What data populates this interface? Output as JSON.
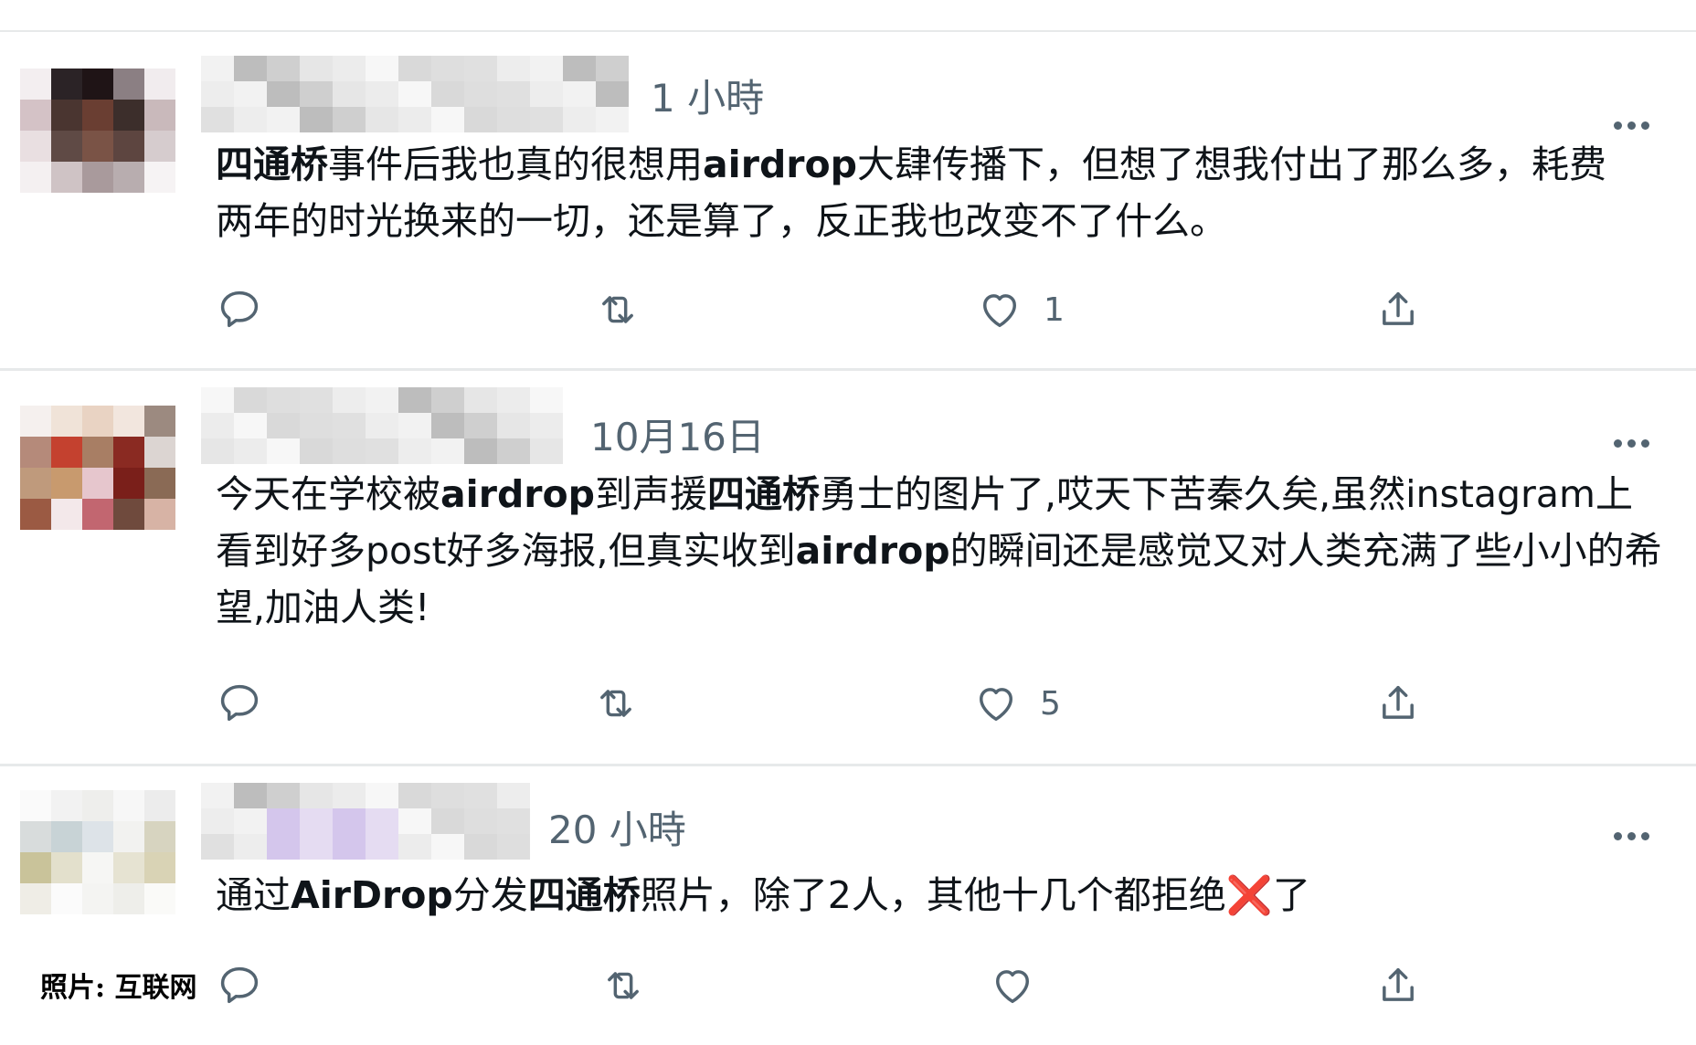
{
  "tweets": [
    {
      "time": "1 小時",
      "text_parts": [
        {
          "t": "四通桥",
          "b": true
        },
        {
          "t": "事件后我也真的很想用",
          "b": false
        },
        {
          "t": "airdrop",
          "b": true
        },
        {
          "t": "大肆传播下，但想了想我付出了那么多，耗费两年的时光换来的一切，还是算了，反正我也改变不了什么。",
          "b": false
        }
      ],
      "likes": "1",
      "avatar_colors": [
        "#f3eef0",
        "#2b2326",
        "#1f1416",
        "#8b7f83",
        "#f1ecee",
        "#d4c2c6",
        "#4a3530",
        "#6a3e32",
        "#3c2e2b",
        "#c9b9bb",
        "#e9dfe1",
        "#5f4a45",
        "#7a5346",
        "#5d4540",
        "#d6ccce",
        "#f4f0f1",
        "#cfc3c5",
        "#a99a9c",
        "#b8adaf",
        "#f6f3f4"
      ]
    },
    {
      "time": "10月16日",
      "text_parts": [
        {
          "t": "今天在学校被",
          "b": false
        },
        {
          "t": "airdrop",
          "b": true
        },
        {
          "t": "到声援",
          "b": false
        },
        {
          "t": "四通桥",
          "b": true
        },
        {
          "t": "勇士的图片了,哎天下苦秦久矣,虽然instagram上看到好多post好多海报,但真实收到",
          "b": false
        },
        {
          "t": "airdrop",
          "b": true
        },
        {
          "t": "的瞬间还是感觉又对人类充满了些小小的希望,加油人类!",
          "b": false
        }
      ],
      "likes": "5",
      "avatar_colors": [
        "#f5f0ee",
        "#f0e3d8",
        "#e9d3c3",
        "#f2e6de",
        "#9c8a80",
        "#b58a7a",
        "#c4412f",
        "#a87e64",
        "#8a2a22",
        "#dcd5d2",
        "#bf9a7c",
        "#c89a6e",
        "#e6c6cd",
        "#7a1f1a",
        "#8a6a55",
        "#9b5a43",
        "#f3e8ea",
        "#c26670",
        "#6f4a3d",
        "#d7b3a5"
      ]
    },
    {
      "time": "20 小時",
      "text_parts": [
        {
          "t": "通过",
          "b": false
        },
        {
          "t": "AirDrop",
          "b": true
        },
        {
          "t": "分发",
          "b": false
        },
        {
          "t": "四通桥",
          "b": true
        },
        {
          "t": "照片，除了2人，其他十几个都拒绝",
          "b": false
        },
        {
          "t": "❌",
          "b": false,
          "x": true
        },
        {
          "t": "了",
          "b": false
        }
      ],
      "likes": "",
      "avatar_colors": [
        "#fafafa",
        "#f2f2f2",
        "#eeeeec",
        "#f7f7f7",
        "#ececec",
        "#d8dcdc",
        "#c8d3d6",
        "#dde3e8",
        "#f2f2f0",
        "#d7d4c0",
        "#c9c39a",
        "#e3e0cc",
        "#f6f6f4",
        "#e6e3d2",
        "#d9d3b5",
        "#efede6",
        "#fbfbfb",
        "#f4f4f2",
        "#eeeeea",
        "#fafaf8"
      ]
    }
  ],
  "credit": "照片: 互联网"
}
